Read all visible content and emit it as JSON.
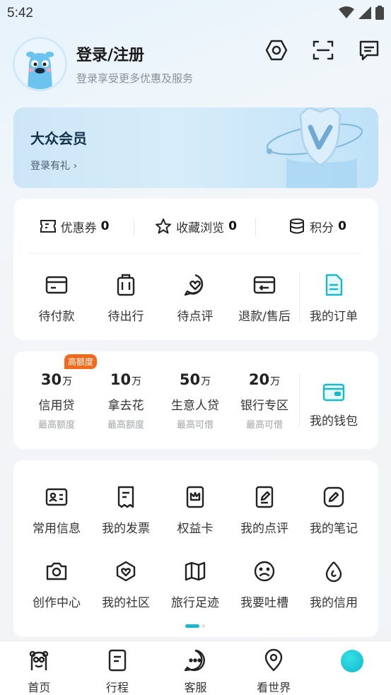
{
  "status_bar": {
    "time": "5:42"
  },
  "header": {
    "title": "登录/注册",
    "subtitle": "登录享受更多优惠及服务",
    "icons": [
      "settings-hex-icon",
      "scan-icon",
      "message-icon"
    ]
  },
  "vip": {
    "title": "大众会员",
    "link": "登录有礼 ›"
  },
  "stats": [
    {
      "label": "优惠券",
      "value": "0",
      "icon": "coupon-icon"
    },
    {
      "label": "收藏浏览",
      "value": "0",
      "icon": "star-icon"
    },
    {
      "label": "积分",
      "value": "0",
      "icon": "coins-icon"
    }
  ],
  "orders": [
    {
      "label": "待付款",
      "icon": "card-icon"
    },
    {
      "label": "待出行",
      "icon": "luggage-icon"
    },
    {
      "label": "待点评",
      "icon": "review-heart-icon"
    },
    {
      "label": "退款/售后",
      "icon": "refund-icon"
    },
    {
      "label": "我的订单",
      "icon": "order-doc-icon"
    }
  ],
  "finance": {
    "badge": "高额度",
    "items": [
      {
        "amount": "30",
        "unit": "万",
        "name": "信用贷",
        "note": "最高额度"
      },
      {
        "amount": "10",
        "unit": "万",
        "name": "拿去花",
        "note": "最高额度"
      },
      {
        "amount": "50",
        "unit": "万",
        "name": "生意人贷",
        "note": "最高可借"
      },
      {
        "amount": "20",
        "unit": "万",
        "name": "银行专区",
        "note": "最高可借"
      }
    ],
    "wallet": {
      "label": "我的钱包",
      "icon": "wallet-icon"
    }
  },
  "tools": {
    "row1": [
      {
        "label": "常用信息",
        "icon": "id-card-icon"
      },
      {
        "label": "我的发票",
        "icon": "invoice-icon"
      },
      {
        "label": "权益卡",
        "icon": "crown-card-icon"
      },
      {
        "label": "我的点评",
        "icon": "edit-note-icon"
      },
      {
        "label": "我的笔记",
        "icon": "pen-icon"
      }
    ],
    "row2": [
      {
        "label": "创作中心",
        "icon": "camera-icon"
      },
      {
        "label": "我的社区",
        "icon": "community-heart-icon"
      },
      {
        "label": "旅行足迹",
        "icon": "map-icon"
      },
      {
        "label": "我要吐槽",
        "icon": "sad-face-icon"
      },
      {
        "label": "我的信用",
        "icon": "drop-icon"
      }
    ]
  },
  "tabbar": [
    {
      "label": "首页",
      "icon": "home-mascot-icon"
    },
    {
      "label": "行程",
      "icon": "itinerary-icon"
    },
    {
      "label": "客服",
      "icon": "chat-icon"
    },
    {
      "label": "看世界",
      "icon": "location-icon"
    },
    {
      "label": "",
      "icon": "ball-icon"
    }
  ],
  "colors": {
    "accent": "#19b9c9",
    "badge": "#f26b1d",
    "vip_bg": "#cde6f7"
  }
}
